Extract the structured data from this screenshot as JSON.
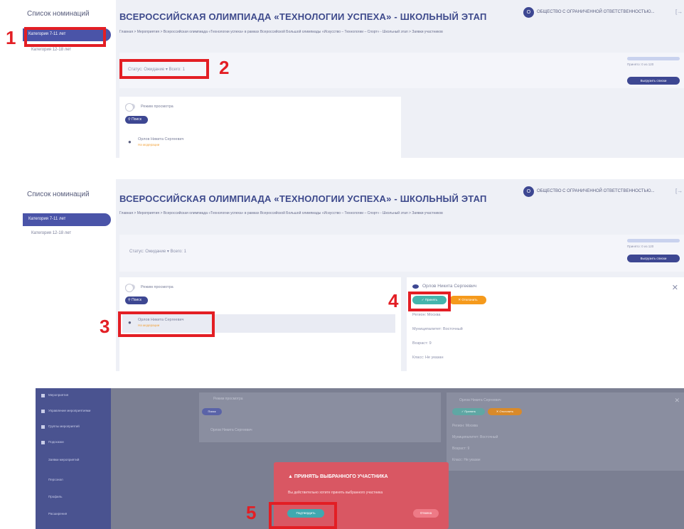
{
  "sidebar": {
    "title": "Список номинаций",
    "items": [
      {
        "label": "Категория 7-11 лет"
      },
      {
        "label": "Категория 12-18 лет"
      }
    ]
  },
  "header": {
    "title": "ВСЕРОССИЙСКАЯ ОЛИМПИАДА «ТЕХНОЛОГИИ УСПЕХА» - ШКОЛЬНЫЙ ЭТАП",
    "breadcrumb": "Главная  >  Мероприятия  >  Всероссийская олимпиада «Технологии успеха» в рамках Всероссийской Большой олимпиады «Искусство – Технологии – Спорт» - Школьный этап  >  Заявки участников",
    "org_avatar": "О",
    "org_name": "ОБЩЕСТВО С ОГРАНИЧЕННОЙ ОТВЕТСТВЕННОСТЬЮ...",
    "logout_icon": "[→"
  },
  "filter": {
    "status_text": "Статус: Ожидание  ▾   Всего: 1",
    "accepted_text": "Принято: 0 из 120",
    "export_label": "Выгрузить списки"
  },
  "list": {
    "view_mode_label": "Режим просмотра",
    "search_label": "Поиск",
    "person_name": "Орлов Никита Сергеевич",
    "person_status": "На модерации"
  },
  "detail": {
    "name": "Орлов Никита Сергеевич",
    "accept_label": "✓  Принять",
    "reject_label": "✕  Отклонить",
    "region": "Регион: Москва",
    "municipality": "Муниципалитет: Восточный",
    "age": "Возраст: 9",
    "class": "Класс: Не указан"
  },
  "sidebar_dim": {
    "items": [
      {
        "label": "Мероприятия"
      },
      {
        "label": "Управление мероприятиями"
      },
      {
        "label": "Группы мероприятий"
      },
      {
        "label": "Подсказки"
      },
      {
        "label": "Заявки мероприятий"
      },
      {
        "label": "Персонал"
      },
      {
        "label": "Профиль"
      },
      {
        "label": "Расширения"
      }
    ]
  },
  "modal": {
    "title": "▲  ПРИНЯТЬ ВЫБРАННОГО УЧАСТНИКА",
    "text": "Вы действительно хотите принять выбранного участника",
    "confirm_label": "Подтвердить",
    "cancel_label": "Отмена"
  },
  "steps": [
    "1",
    "2",
    "3",
    "4",
    "5"
  ],
  "colors": {
    "accent": "#3d4792",
    "highlight": "#e31e24",
    "accept": "#45b5ad",
    "reject": "#f59a1c",
    "modal": "#d95763"
  }
}
